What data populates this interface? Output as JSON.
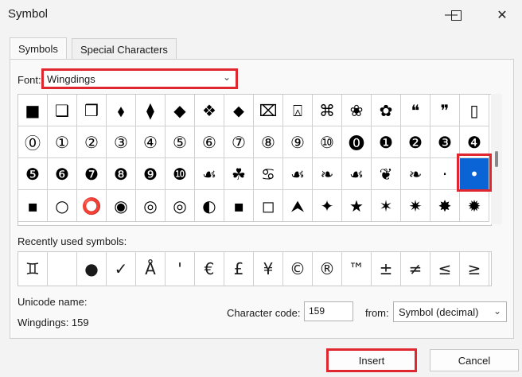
{
  "window": {
    "title": "Symbol"
  },
  "tabs": [
    {
      "label": "Symbols"
    },
    {
      "label": "Special Characters"
    }
  ],
  "font": {
    "label": "Font:",
    "value": "Wingdings"
  },
  "grid": {
    "rows": [
      [
        "■",
        "❑",
        "❒",
        "⬧",
        "⧫",
        "◆",
        "❖",
        "⬥",
        "⌧",
        "⍓",
        "⌘",
        "❀",
        "✿",
        "❝",
        "❞",
        "▯"
      ],
      [
        "⓪",
        "①",
        "②",
        "③",
        "④",
        "⑤",
        "⑥",
        "⑦",
        "⑧",
        "⑨",
        "⑩",
        "⓿",
        "❶",
        "❷",
        "❸",
        "❹"
      ],
      [
        "❺",
        "❻",
        "❼",
        "❽",
        "❾",
        "❿",
        "☙",
        "☘",
        "♋",
        "☙",
        "❧",
        "☙",
        "❦",
        "❧",
        "·",
        "•"
      ],
      [
        "▪",
        "○",
        "⭕",
        "◉",
        "◎",
        "◎",
        "◐",
        "▪",
        "◻",
        "⮝",
        "✦",
        "★",
        "✶",
        "✷",
        "✸",
        "✹"
      ]
    ],
    "selected": {
      "row": 2,
      "col": 15
    }
  },
  "recent": {
    "label": "Recently used symbols:",
    "symbols": [
      "♊",
      "",
      "●",
      "✓",
      "Å",
      "'",
      "€",
      "£",
      "¥",
      "©",
      "®",
      "™",
      "±",
      "≠",
      "≤",
      "≥"
    ]
  },
  "unicode": {
    "label": "Unicode name:",
    "value": "Wingdings: 159"
  },
  "charcode": {
    "label": "Character code:",
    "value": "159"
  },
  "from": {
    "label": "from:",
    "value": "Symbol (decimal)"
  },
  "buttons": {
    "insert": "Insert",
    "cancel": "Cancel"
  },
  "colors": {
    "highlight": "#e0262e",
    "selection": "#0a64d6"
  }
}
